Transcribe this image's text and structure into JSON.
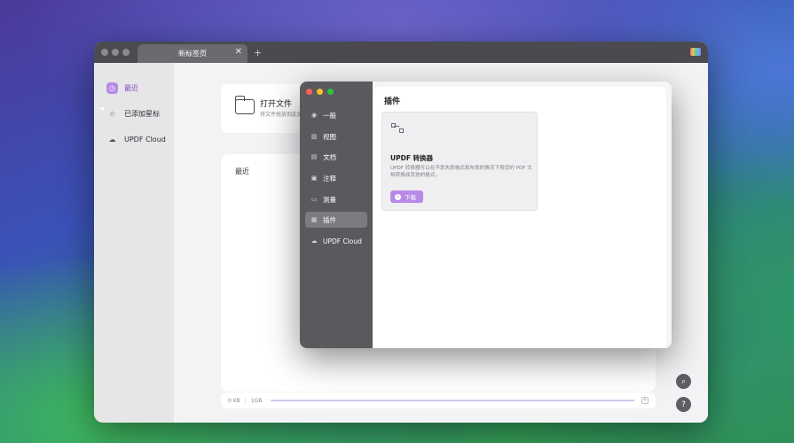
{
  "tab": {
    "title": "新标签页",
    "close_glyph": "✕",
    "add_glyph": "+"
  },
  "sidebar": {
    "items": [
      {
        "label": "最近",
        "icon": "clock-icon"
      },
      {
        "label": "已添加星标",
        "icon": "star-icon"
      },
      {
        "label": "UPDF Cloud",
        "icon": "cloud-icon"
      }
    ]
  },
  "main": {
    "open_file": {
      "title": "打开文件",
      "subtitle": "将文件拖放到此处"
    },
    "recent_title": "最近",
    "storage": {
      "used": "0 KB",
      "total": "1GB",
      "used_fraction": 0,
      "add_glyph": "+"
    }
  },
  "buttons": {
    "search_glyph": "⌕",
    "help_glyph": "?"
  },
  "settings_dialog": {
    "nav": [
      {
        "label": "一般",
        "icon": "general-icon"
      },
      {
        "label": "视图",
        "icon": "view-icon"
      },
      {
        "label": "文档",
        "icon": "document-icon"
      },
      {
        "label": "注释",
        "icon": "comment-icon"
      },
      {
        "label": "测量",
        "icon": "ruler-icon"
      },
      {
        "label": "插件",
        "icon": "plugin-icon",
        "active": true
      },
      {
        "label": "UPDF Cloud",
        "icon": "cloud-icon"
      }
    ],
    "title": "插件",
    "plugin": {
      "name": "UPDF 转换器",
      "description": "UPDF 转换器可以在不丢失原格式和布局的情况下将您的 PDF 文档转换成其他的格式。",
      "download_label": "下载"
    }
  },
  "colors": {
    "accent": "#b88ae8",
    "dialog_sidebar": "#5a5a5e",
    "traffic_red": "#fe5f57",
    "traffic_yellow": "#febc2e",
    "traffic_green": "#28c840"
  }
}
